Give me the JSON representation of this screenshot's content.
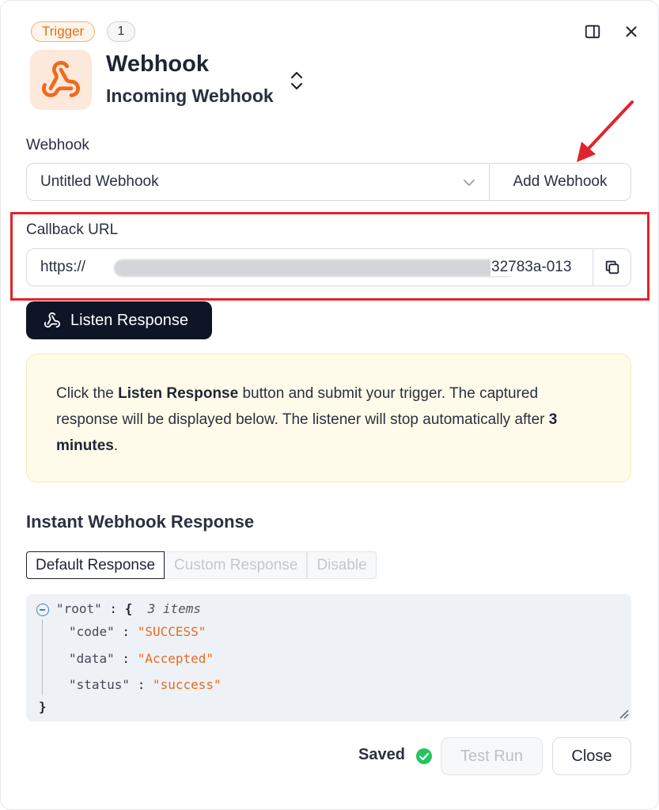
{
  "header": {
    "badge_label": "Trigger",
    "badge_count": "1",
    "panel_toggle_icon": "sidebar-panel-icon",
    "close_icon": "close-icon"
  },
  "node": {
    "icon": "webhook-icon",
    "title": "Webhook",
    "subtitle": "Incoming Webhook"
  },
  "webhook": {
    "label": "Webhook",
    "selected": "Untitled Webhook",
    "add_button": "Add Webhook"
  },
  "callback": {
    "label": "Callback URL",
    "url_prefix": "https://",
    "url_suffix": "32783a-013",
    "copy_icon": "copy-icon"
  },
  "listen_button": "Listen Response",
  "info": {
    "text_1": "Click the ",
    "bold_1": "Listen Response",
    "text_2": " button and submit your trigger. The captured response will be displayed below. The listener will stop automatically after ",
    "bold_2": "3 minutes",
    "text_3": "."
  },
  "response": {
    "title": "Instant Webhook Response",
    "tabs": [
      "Default Response",
      "Custom Response",
      "Disable"
    ],
    "json": {
      "root_key": "\"root\"",
      "items_meta": "3 items",
      "entries": [
        {
          "key": "\"code\"",
          "value": "\"SUCCESS\""
        },
        {
          "key": "\"data\"",
          "value": "\"Accepted\""
        },
        {
          "key": "\"status\"",
          "value": "\"success\""
        }
      ]
    }
  },
  "footer": {
    "saved_label": "Saved",
    "test_run": "Test Run",
    "close": "Close"
  },
  "colors": {
    "accent_orange": "#e76c1e",
    "highlight_red": "#e0242c",
    "dark_button": "#0d1527",
    "saved_green": "#22c55e"
  }
}
